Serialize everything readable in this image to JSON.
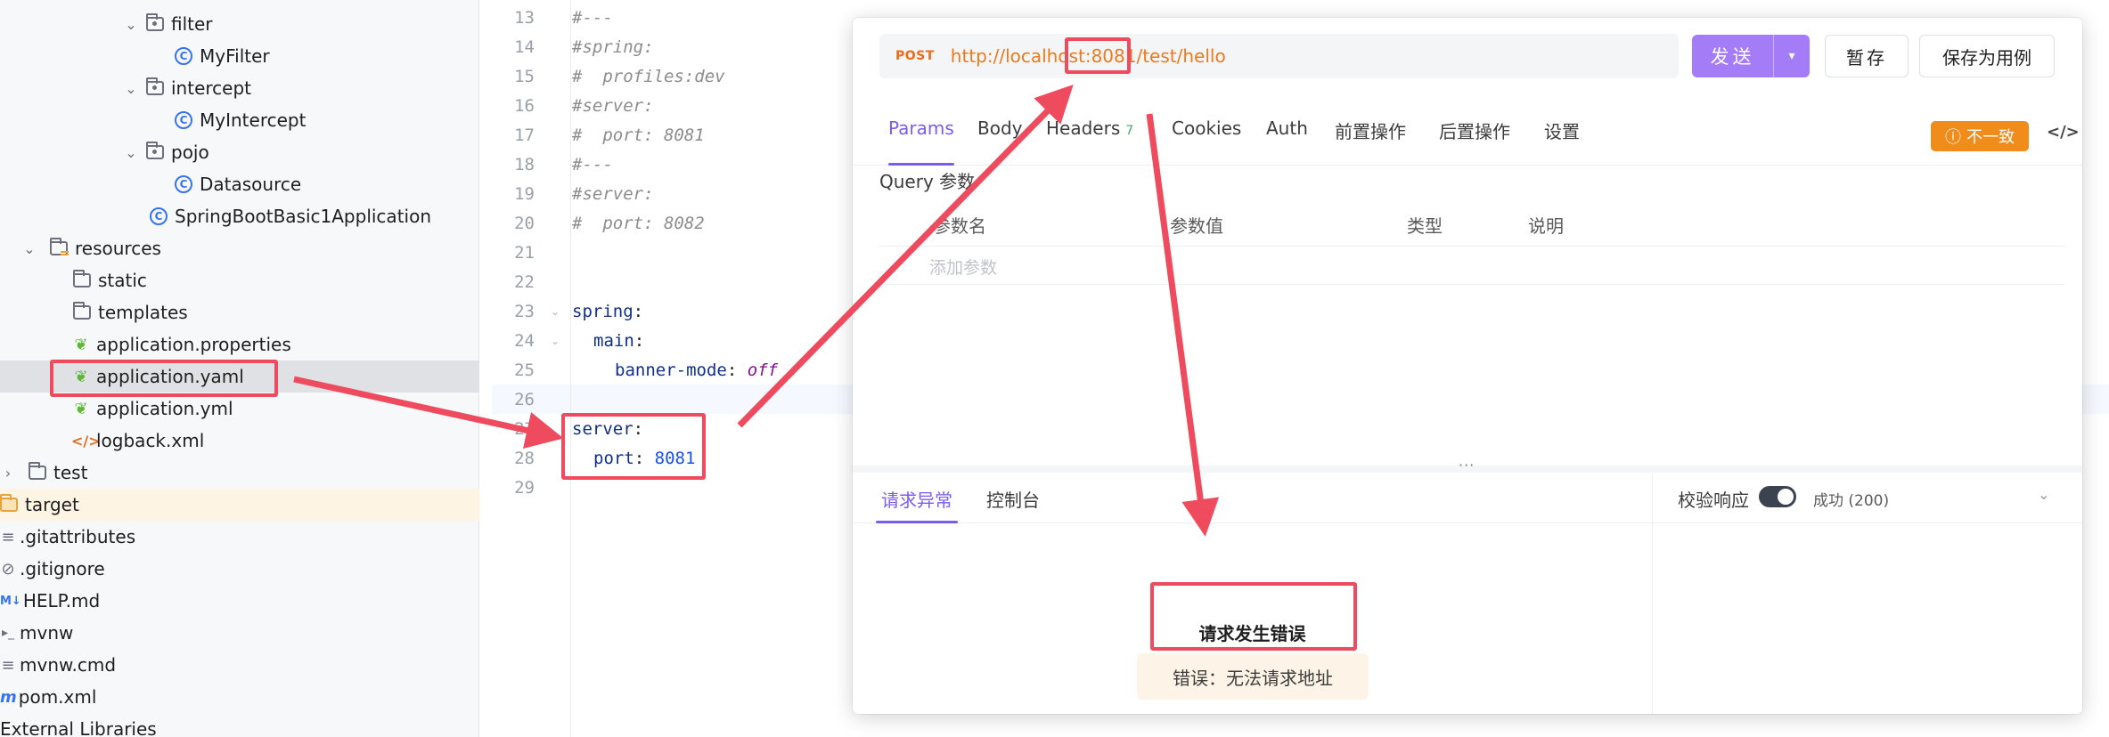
{
  "tree": {
    "items": [
      {
        "label": "filter",
        "kind": "package",
        "expanded": true
      },
      {
        "label": "MyFilter",
        "kind": "class"
      },
      {
        "label": "intercept",
        "kind": "package",
        "expanded": true
      },
      {
        "label": "MyIntercept",
        "kind": "class"
      },
      {
        "label": "pojo",
        "kind": "package",
        "expanded": true
      },
      {
        "label": "Datasource",
        "kind": "class"
      },
      {
        "label": "SpringBootBasic1Application",
        "kind": "spring-class"
      },
      {
        "label": "resources",
        "kind": "resource-folder",
        "expanded": true
      },
      {
        "label": "static",
        "kind": "folder"
      },
      {
        "label": "templates",
        "kind": "folder"
      },
      {
        "label": "application.properties",
        "kind": "spring-config"
      },
      {
        "label": "application.yaml",
        "kind": "spring-config",
        "selected": true
      },
      {
        "label": "application.yml",
        "kind": "spring-config"
      },
      {
        "label": "logback.xml",
        "kind": "xml"
      },
      {
        "label": "test",
        "kind": "folder",
        "expanded": false
      },
      {
        "label": "target",
        "kind": "target-folder"
      },
      {
        "label": ".gitattributes",
        "kind": "text"
      },
      {
        "label": ".gitignore",
        "kind": "ignore"
      },
      {
        "label": "HELP.md",
        "kind": "markdown"
      },
      {
        "label": "mvnw",
        "kind": "shell"
      },
      {
        "label": "mvnw.cmd",
        "kind": "text"
      },
      {
        "label": "pom.xml",
        "kind": "maven"
      },
      {
        "label": "External Libraries",
        "kind": "libraries"
      }
    ]
  },
  "editor": {
    "line_numbers": [
      "13",
      "14",
      "15",
      "16",
      "17",
      "18",
      "19",
      "20",
      "21",
      "22",
      "23",
      "24",
      "25",
      "26",
      "27",
      "28",
      "29"
    ],
    "lines": {
      "l13": "#---",
      "l14": "#spring:",
      "l15": "#  profiles:dev",
      "l16": "#server:",
      "l17": "#  port: 8081",
      "l18": "#---",
      "l19": "#server:",
      "l20": "#  port: 8082",
      "l23_key": "spring",
      "l24_key": "main",
      "l25_key": "banner-mode",
      "l25_val": "off",
      "l27_key": "server",
      "l28_key": "port",
      "l28_val": "8081",
      "colon": ":"
    }
  },
  "api": {
    "method": "POST",
    "url": "http://localhost:8081/test/hello",
    "send_label": "发送",
    "stash_label": "暂存",
    "save_case_label": "保存为用例",
    "tabs": {
      "params": "Params",
      "body": "Body",
      "headers": "Headers",
      "headers_count": "7",
      "cookies": "Cookies",
      "auth": "Auth",
      "pre": "前置操作",
      "post": "后置操作",
      "settings": "设置"
    },
    "mismatch_label": "不一致",
    "query_label": "Query 参数",
    "columns": {
      "name": "参数名",
      "value": "参数值",
      "type": "类型",
      "desc": "说明"
    },
    "add_param_placeholder": "添加参数",
    "response_tabs": {
      "error": "请求异常",
      "console": "控制台"
    },
    "verify_label": "校验响应",
    "status": "成功 (200)",
    "error_title": "请求发生错误",
    "error_detail": "错误：无法请求地址"
  },
  "colors": {
    "annotation": "#ef4b5f",
    "accent": "#7c5cf0",
    "send_button": "#a57cf7",
    "method": "#ec6b1b",
    "warning": "#f08c1a"
  }
}
